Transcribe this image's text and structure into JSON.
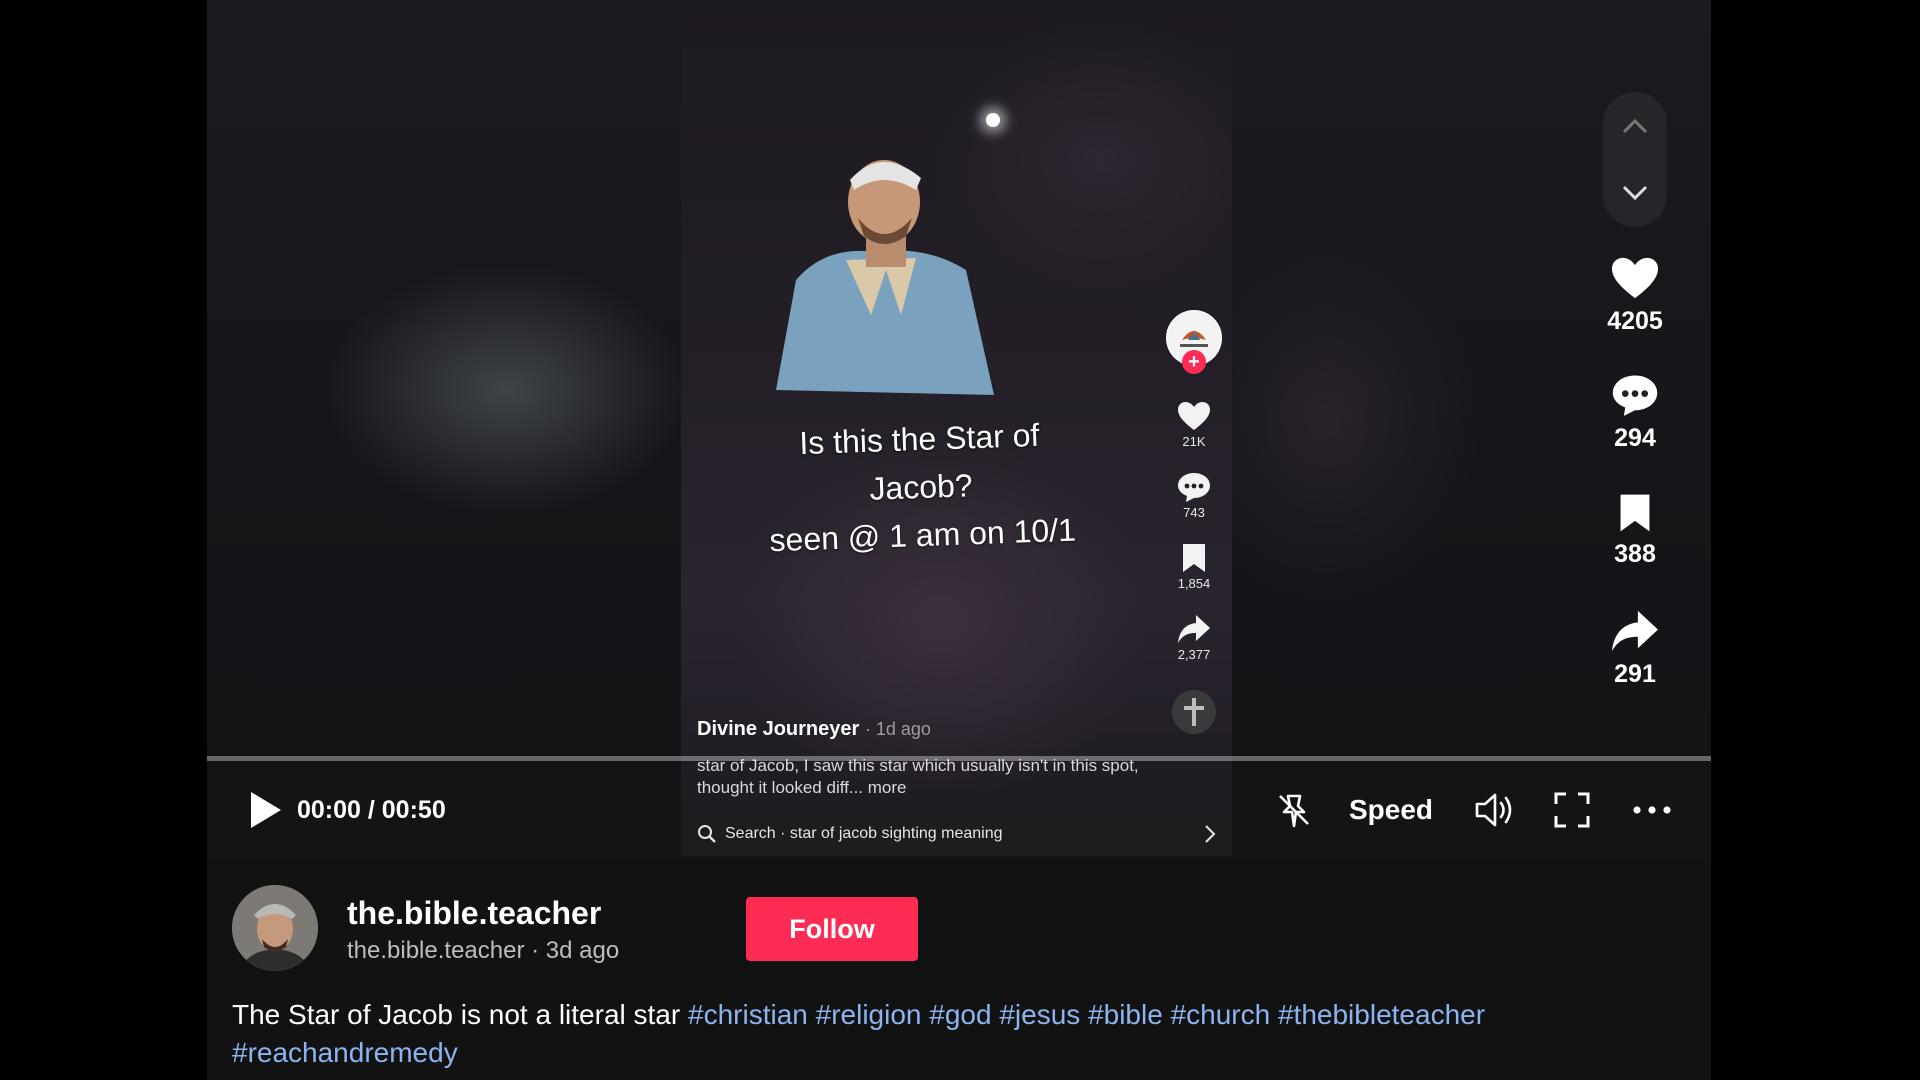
{
  "video_frame": {
    "caption_lines": [
      "Is this the Star of",
      "Jacob?",
      "seen @ 1 am on 10/1"
    ],
    "actions": [
      {
        "icon": "heart-icon",
        "count": "21K"
      },
      {
        "icon": "comment-icon",
        "count": "743"
      },
      {
        "icon": "bookmark-icon",
        "count": "1,854"
      },
      {
        "icon": "share-icon",
        "count": "2,377"
      }
    ],
    "author": "Divine Journeyer",
    "age": "· 1d ago",
    "description": "star of Jacob, I saw this star which usually isn't in this spot, thought it looked diff... more",
    "search_text": "Search · star of jacob sighting meaning"
  },
  "player": {
    "time": "00:00 / 00:50",
    "speed_label": "Speed",
    "progress": 0
  },
  "rail": {
    "likes": "4205",
    "comments": "294",
    "saves": "388",
    "shares": "291"
  },
  "post": {
    "username": "the.bible.teacher",
    "subline": "the.bible.teacher · 3d ago",
    "follow_label": "Follow",
    "description_text": "The Star of Jacob is not a literal star",
    "hashtags": [
      "#christian",
      "#religion",
      "#god",
      "#jesus",
      "#bible",
      "#church",
      "#thebibleteacher",
      "#reachandremedy"
    ]
  },
  "colors": {
    "accent": "#fe2c55",
    "hashtag": "#8bb4f0",
    "background": "#121212"
  }
}
